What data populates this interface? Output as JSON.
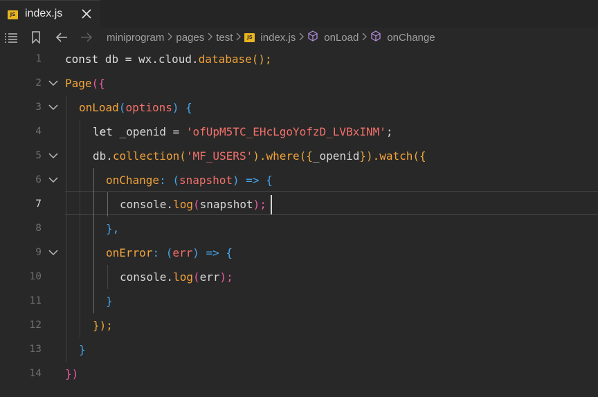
{
  "tab": {
    "icon": "js-file-icon",
    "badge": "JS",
    "title": "index.js",
    "close_icon": "close-icon"
  },
  "breadcrumb": {
    "items": [
      "miniprogram",
      "pages",
      "test",
      "index.js",
      "onLoad",
      "onChange"
    ],
    "icons": [
      "outline-icon",
      "bookmark-icon",
      "arrow-left-icon",
      "arrow-right-icon",
      "chevron-right-icon",
      "cube-icon"
    ]
  },
  "editor": {
    "line_numbers": [
      "1",
      "2",
      "3",
      "4",
      "5",
      "6",
      "7",
      "8",
      "9",
      "10",
      "11",
      "12",
      "13",
      "14"
    ],
    "active_line": "7",
    "lines": [
      [
        "const",
        " db = wx.cloud.",
        "database",
        "();"
      ],
      [
        "Page",
        "({"
      ],
      [
        "onLoad",
        "(",
        "options",
        ") {"
      ],
      [
        "let",
        " _openid = ",
        "'ofUpM5TC_EHcLgoYofzD_LVBxINM'",
        ";"
      ],
      [
        "db.",
        "collection",
        "(",
        "'MF_USERS'",
        ").",
        "where",
        "({",
        "_openid",
        "}).",
        "watch",
        "({"
      ],
      [
        "onChange",
        ": (",
        "snapshot",
        ") => {"
      ],
      [
        "console.",
        "log",
        "(",
        "snapshot",
        ");"
      ],
      [
        "},"
      ],
      [
        "onError",
        ": (",
        "err",
        ") => {"
      ],
      [
        "console.",
        "log",
        "(",
        "err",
        ");"
      ],
      [
        "}"
      ],
      [
        "});"
      ],
      [
        "}"
      ],
      [
        "})"
      ]
    ]
  },
  "colors": {
    "background": "#282828",
    "keyword": "#e5e5e5",
    "function": "#f3a33a",
    "string": "#f2706b",
    "bracket_pink": "#ea5aa7",
    "bracket_gold": "#e6a93c",
    "bracket_blue": "#44a5e8",
    "js_badge": "#e8b521"
  }
}
